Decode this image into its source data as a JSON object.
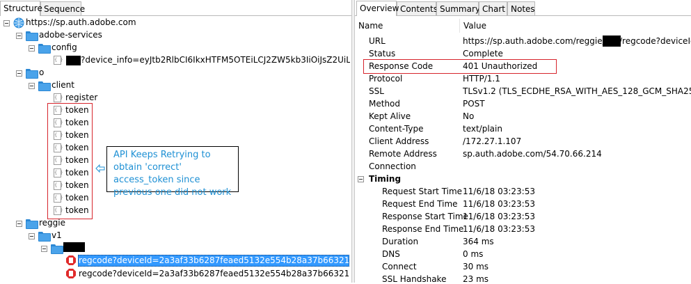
{
  "left_tabs": [
    "Structure",
    "Sequence"
  ],
  "right_tabs": [
    "Overview",
    "Contents",
    "Summary",
    "Chart",
    "Notes"
  ],
  "tree": {
    "root": "https://sp.auth.adobe.com",
    "adobe_services": "adobe-services",
    "config": "config",
    "config_request": "?device_info=eyJtb2RlbCI6IkxHTFM5OTEiLCJ2ZW5kb3IiOiJsZ2UiLCJ2ZXJza",
    "o": "o",
    "client": "client",
    "register": "register",
    "tokens": [
      "token",
      "token",
      "token",
      "token",
      "token",
      "token",
      "token",
      "token",
      "token"
    ],
    "reggie": "reggie",
    "v1": "v1",
    "regcode_1": "regcode?deviceId=2a3af33b6287feaed5132e554b28a37b66321261ae0017a3",
    "regcode_2": "regcode?deviceId=2a3af33b6287feaed5132e554b28a37b66321261ae0017a3"
  },
  "annotation": "API Keeps Retrying to obtain 'correct' access_token since previous one did not work",
  "overview": {
    "col_name": "Name",
    "col_value": "Value",
    "rows": [
      {
        "name": "URL",
        "value": "https://sp.auth.adobe.com/reggie/v1/"
      },
      {
        "name": "Status",
        "value": "Complete"
      },
      {
        "name": "Response Code",
        "value": "401 Unauthorized"
      },
      {
        "name": "Protocol",
        "value": "HTTP/1.1"
      },
      {
        "name": "SSL",
        "value": "TLSv1.2 (TLS_ECDHE_RSA_WITH_AES_128_GCM_SHA256)"
      },
      {
        "name": "Method",
        "value": "POST"
      },
      {
        "name": "Kept Alive",
        "value": "No"
      },
      {
        "name": "Content-Type",
        "value": "text/plain"
      },
      {
        "name": "Client Address",
        "value": "/172.27.1.107"
      },
      {
        "name": "Remote Address",
        "value": "sp.auth.adobe.com/54.70.66.214"
      },
      {
        "name": "Connection",
        "value": ""
      }
    ],
    "url_suffix": "/regcode?deviceId=",
    "timing_label": "Timing",
    "timing": [
      {
        "name": "Request Start Time",
        "value": "11/6/18 03:23:53"
      },
      {
        "name": "Request End Time",
        "value": "11/6/18 03:23:53"
      },
      {
        "name": "Response Start Time",
        "value": "11/6/18 03:23:53"
      },
      {
        "name": "Response End Time",
        "value": "11/6/18 03:23:53"
      },
      {
        "name": "Duration",
        "value": "364 ms"
      },
      {
        "name": "DNS",
        "value": "0 ms"
      },
      {
        "name": "Connect",
        "value": "30 ms"
      },
      {
        "name": "SSL Handshake",
        "value": "23 ms"
      }
    ]
  },
  "colors": {
    "highlight": "#d6242c",
    "annotation_text": "#1e90d4",
    "selection": "#3399ff",
    "folder": "#4aa3ea"
  }
}
